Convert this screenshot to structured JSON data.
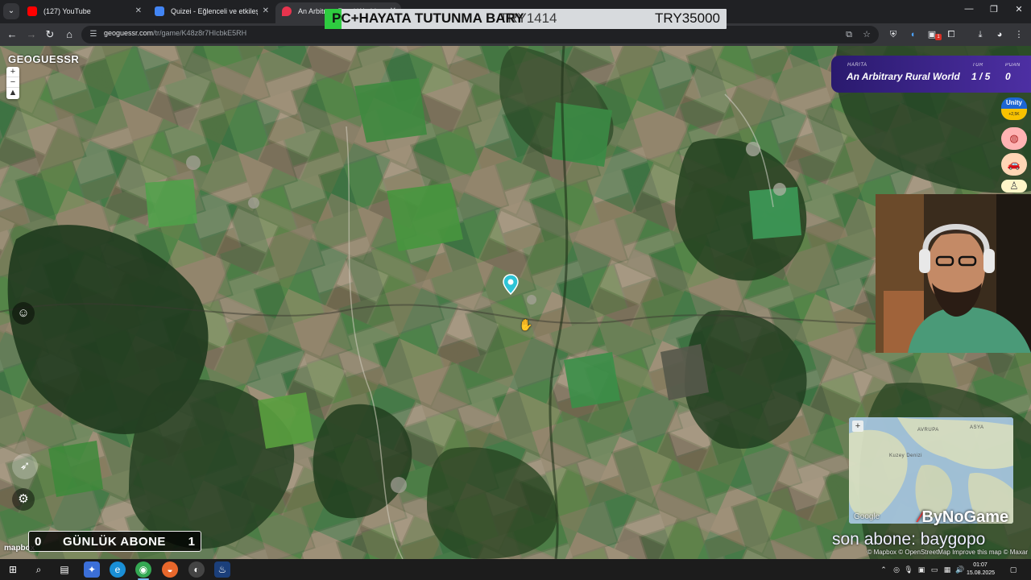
{
  "browser": {
    "tabs": [
      {
        "label": "(127) YouTube",
        "favicon_color": "#ff0000"
      },
      {
        "label": "Quizei - Eğlenceli ve etkileşimli",
        "favicon_color": "#4285f4"
      },
      {
        "label": "An Arbitrary Rural World",
        "favicon_color": "#e8344e"
      }
    ],
    "url_host": "geoguessr.com",
    "url_path": "/tr/game/K48z8r7HIcbkE5RH"
  },
  "ticker": {
    "headline": "PC+HAYATA TUTUNMA BARY",
    "goal_current": "TRY1414",
    "goal_target": "TRY35000"
  },
  "geoguessr": {
    "logo": "GEOGUESSR",
    "status": {
      "map_label": "HARİTA",
      "map_value": "An Arbitrary Rural World",
      "round_label": "TUR",
      "round_value": "1 / 5",
      "score_label": "PUAN",
      "score_value": "0"
    },
    "unity": {
      "title": "Unity",
      "sub": "+2,5K"
    },
    "minimap_labels": {
      "europe": "AVRUPA",
      "asia": "ASYA",
      "north_sea": "Kuzey Denizi"
    },
    "google_mark": "Google",
    "attribution": "© Mapbox © OpenStreetMap Improve this map © Maxar",
    "mapbox": "mapbox"
  },
  "stream": {
    "brand": "ByNoGame",
    "last_subscriber": "son abone: baygopo",
    "daily_subs_left": "0",
    "daily_subs_label": "GÜNLÜK ABONE",
    "daily_subs_right": "1"
  },
  "taskbar": {
    "time": "01:07",
    "date": "15.08.2025"
  },
  "colors": {
    "status_panel": "#4d2fa3",
    "marker": "#2ec4d6",
    "ticker_green": "#2ecc40"
  }
}
